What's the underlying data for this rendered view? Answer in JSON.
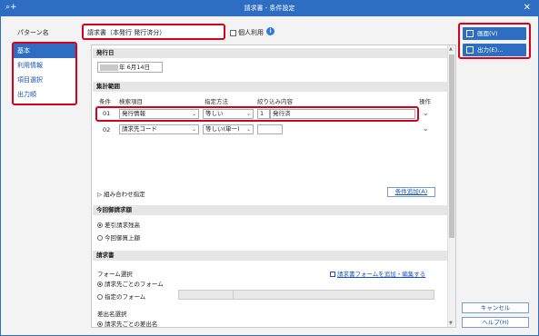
{
  "window": {
    "title": "請求書 - 条件設定",
    "app_icon": "⌕+",
    "close": "✕"
  },
  "pattern_label": "パターン名",
  "pattern_name": "請求書（本発行 発行済分）",
  "personal_use": "個人利用",
  "sidebar": {
    "items": [
      {
        "label": "基本"
      },
      {
        "label": "利用情報"
      },
      {
        "label": "項目選択"
      },
      {
        "label": "出力順"
      }
    ]
  },
  "sections": {
    "issue_date": "発行日",
    "aggregation": "集計範囲",
    "prev_billing": "今回御請求額",
    "invoice": "請求書"
  },
  "date_value": "年  6月14日",
  "table": {
    "headers": {
      "cond": "条件",
      "item": "検索項目",
      "method": "指定方法",
      "content": "絞り込み内容",
      "op": "操作"
    },
    "rows": [
      {
        "num": "01",
        "item": "発行情報",
        "method": "等しい",
        "content_num": "1",
        "content_text": "発行済"
      },
      {
        "num": "02",
        "item": "請求先コード",
        "method": "等しい(単一)",
        "content_num": "",
        "content_text": ""
      }
    ]
  },
  "combo_label": "組み合わせ指定",
  "add_condition": "条件追加(A)",
  "billing_options": [
    "差引請求残高",
    "今回御買上額"
  ],
  "form_select": {
    "label": "フォーム選択",
    "options": [
      "請求先ごとのフォーム",
      "指定のフォーム"
    ],
    "link": "請求書フォームを追加・編集する"
  },
  "sender_select": {
    "label": "差出名選択",
    "options": [
      "請求先ごとの差出名"
    ]
  },
  "buttons": {
    "screen": "画面(V)",
    "output": "出力(E)...",
    "cancel": "キャンセル",
    "help": "ヘルプ(H)"
  }
}
